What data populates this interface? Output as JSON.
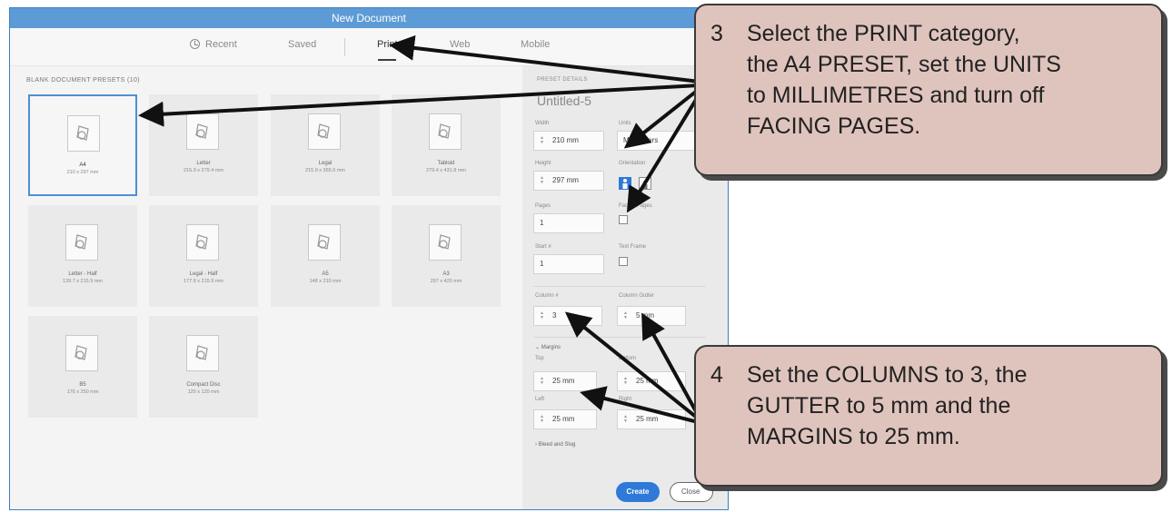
{
  "window": {
    "title": "New Document"
  },
  "tabs": [
    {
      "label": "Recent"
    },
    {
      "label": "Saved"
    },
    {
      "label": "Print"
    },
    {
      "label": "Web"
    },
    {
      "label": "Mobile"
    }
  ],
  "presets": {
    "heading": "BLANK DOCUMENT PRESETS  (10)",
    "items": [
      {
        "name": "A4",
        "size": "210 x 297 mm"
      },
      {
        "name": "Letter",
        "size": "215.9 x 279.4 mm"
      },
      {
        "name": "Legal",
        "size": "215.9 x 355.6 mm"
      },
      {
        "name": "Tabloid",
        "size": "279.4 x 431.8 mm"
      },
      {
        "name": "Letter - Half",
        "size": "139.7 x 215.9 mm"
      },
      {
        "name": "Legal - Half",
        "size": "177.8 x 215.9 mm"
      },
      {
        "name": "A5",
        "size": "148 x 210 mm"
      },
      {
        "name": "A3",
        "size": "297 x 420 mm"
      },
      {
        "name": "B5",
        "size": "176 x 250 mm"
      },
      {
        "name": "Compact Disc",
        "size": "120 x 120 mm"
      }
    ]
  },
  "details": {
    "heading": "PRESET DETAILS",
    "doc_name": "Untitled-5",
    "width_label": "Width",
    "width_value": "210 mm",
    "units_label": "Units",
    "units_value": "Millimeters",
    "height_label": "Height",
    "height_value": "297 mm",
    "orientation_label": "Orientation",
    "pages_label": "Pages",
    "pages_value": "1",
    "facing_label": "Facing Pages",
    "start_label": "Start #",
    "start_value": "1",
    "textframe_label": "Text Frame",
    "column_label": "Column #",
    "column_value": "3",
    "gutter_label": "Column Gutter",
    "gutter_value": "5 mm",
    "margins_label": "Margins",
    "top_label": "Top",
    "top_value": "25 mm",
    "bottom_label": "Bottom",
    "bottom_value": "25 mm",
    "left_label": "Left",
    "left_value": "25 mm",
    "right_label": "Right",
    "right_value": "25 mm",
    "bleed_label": "Bleed and Slug",
    "create_label": "Create",
    "close_label": "Close"
  },
  "callouts": [
    {
      "number": "3",
      "lines": [
        "Select the PRINT category,",
        "the A4 PRESET, set the UNITS",
        "to MILLIMETRES and turn off",
        "FACING PAGES."
      ]
    },
    {
      "number": "4",
      "lines": [
        "Set the COLUMNS to 3, the",
        "GUTTER to 5 mm and the",
        "MARGINS to 25 mm."
      ]
    }
  ],
  "colors": {
    "accent": "#2f7ad8",
    "titlebar": "#5d9bd6",
    "callout_bg": "#dfc4bd"
  }
}
